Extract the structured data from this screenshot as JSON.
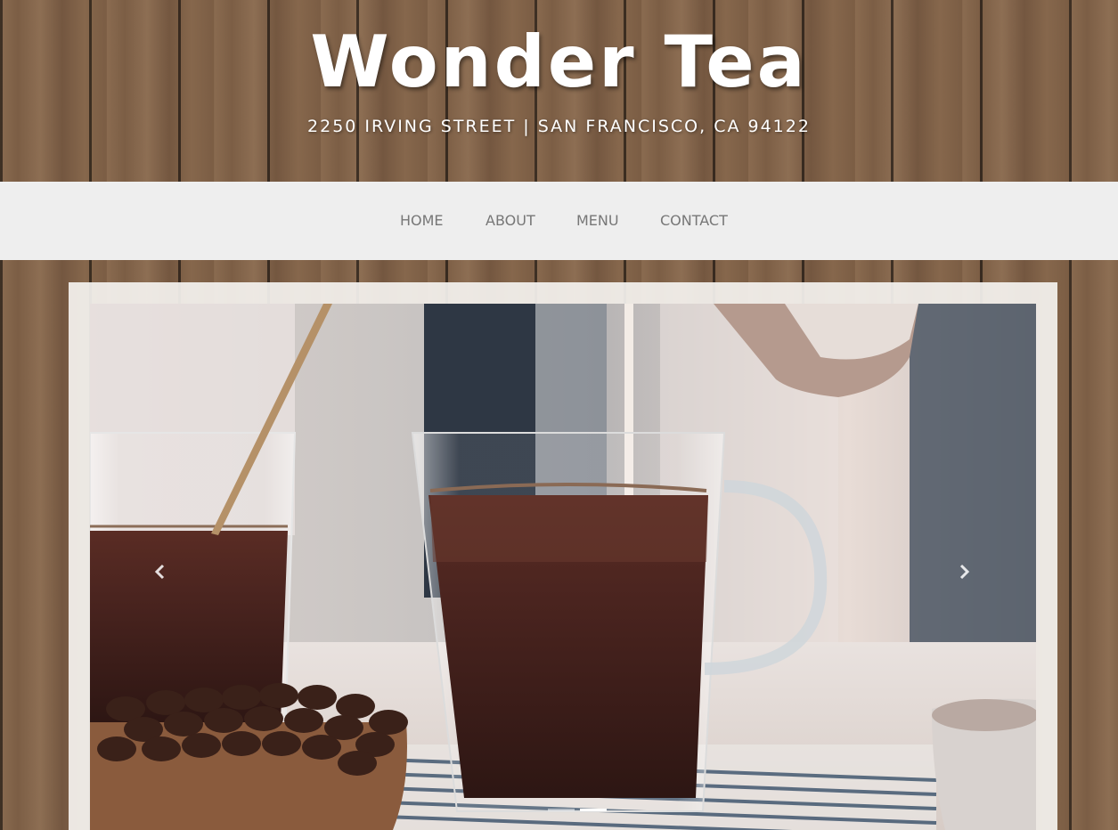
{
  "header": {
    "title": "Wonder Tea",
    "address": "2250 IRVING STREET | SAN FRANCISCO, CA 94122"
  },
  "nav": {
    "items": [
      {
        "label": "HOME"
      },
      {
        "label": "ABOUT"
      },
      {
        "label": "MENU"
      },
      {
        "label": "CONTACT"
      }
    ]
  },
  "carousel": {
    "slide_icon": "tea-photo",
    "prev_icon": "chevron-left-icon",
    "next_icon": "chevron-right-icon",
    "slide_count": 2,
    "active_slide": 2
  },
  "colors": {
    "nav_background": "#eeeeee",
    "nav_text": "#777777",
    "title_text": "#ffffff"
  }
}
